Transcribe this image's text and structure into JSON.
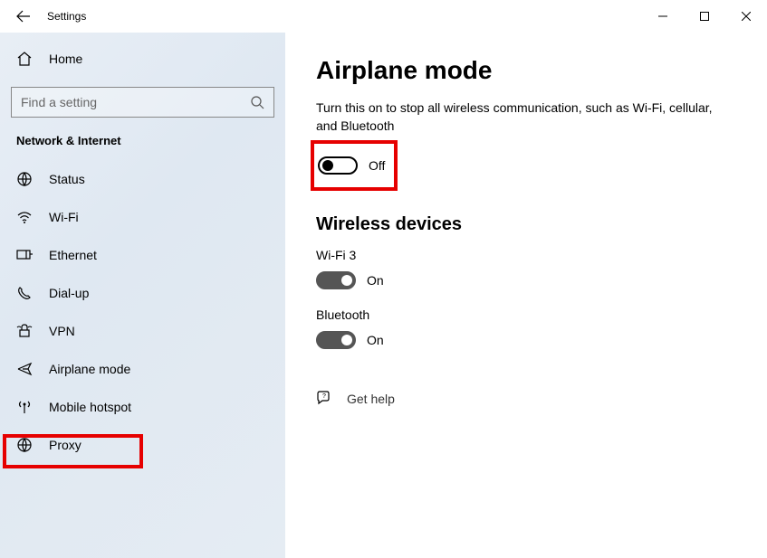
{
  "window": {
    "title": "Settings"
  },
  "sidebar": {
    "home_label": "Home",
    "search_placeholder": "Find a setting",
    "category": "Network & Internet",
    "items": [
      {
        "label": "Status"
      },
      {
        "label": "Wi-Fi"
      },
      {
        "label": "Ethernet"
      },
      {
        "label": "Dial-up"
      },
      {
        "label": "VPN"
      },
      {
        "label": "Airplane mode"
      },
      {
        "label": "Mobile hotspot"
      },
      {
        "label": "Proxy"
      }
    ]
  },
  "main": {
    "heading": "Airplane mode",
    "description": "Turn this on to stop all wireless communication, such as Wi-Fi, cellular, and Bluetooth",
    "airplane_toggle": {
      "state_label": "Off"
    },
    "wireless_heading": "Wireless devices",
    "wifi": {
      "label": "Wi-Fi 3",
      "state_label": "On"
    },
    "bluetooth": {
      "label": "Bluetooth",
      "state_label": "On"
    },
    "help": "Get help"
  }
}
